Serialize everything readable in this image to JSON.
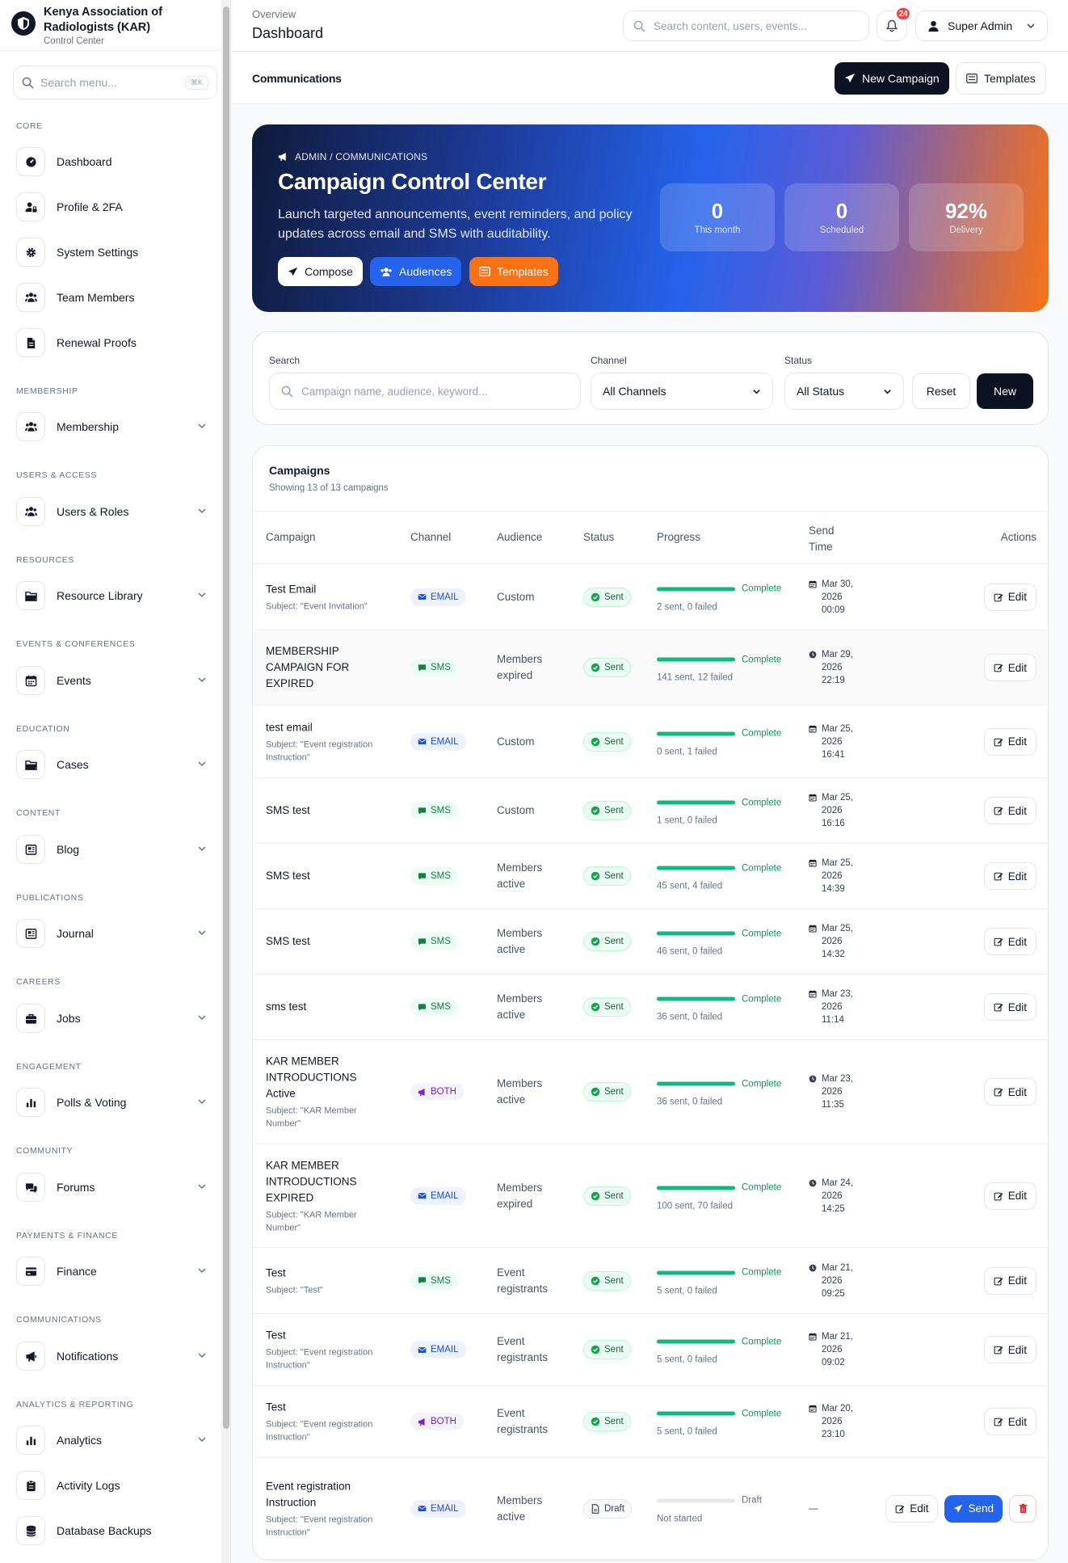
{
  "sidebar": {
    "brand_name": "Kenya Association of Radiologists (KAR)",
    "brand_sub": "Control Center",
    "search_placeholder": "Search menu...",
    "search_kbd": "⌘K",
    "sections": [
      {
        "label": "CORE"
      },
      {
        "label": "MEMBERSHIP"
      },
      {
        "label": "USERS & ACCESS"
      },
      {
        "label": "RESOURCES"
      },
      {
        "label": "EVENTS & CONFERENCES"
      },
      {
        "label": "EDUCATION"
      },
      {
        "label": "CONTENT"
      },
      {
        "label": "PUBLICATIONS"
      },
      {
        "label": "CAREERS"
      },
      {
        "label": "ENGAGEMENT"
      },
      {
        "label": "COMMUNITY"
      },
      {
        "label": "PAYMENTS & FINANCE"
      },
      {
        "label": "COMMUNICATIONS"
      },
      {
        "label": "ANALYTICS & REPORTING"
      }
    ],
    "items": [
      {
        "label": "Dashboard",
        "icon": "dashboard-icon"
      },
      {
        "label": "Profile & 2FA",
        "icon": "user-lock-icon"
      },
      {
        "label": "System Settings",
        "icon": "gear-icon"
      },
      {
        "label": "Team Members",
        "icon": "users-icon"
      },
      {
        "label": "Renewal Proofs",
        "icon": "file-icon"
      },
      {
        "label": "Membership",
        "icon": "users-icon"
      },
      {
        "label": "Users & Roles",
        "icon": "users-icon"
      },
      {
        "label": "Resource Library",
        "icon": "folder-icon"
      },
      {
        "label": "Events",
        "icon": "calendar-icon"
      },
      {
        "label": "Cases",
        "icon": "folder-icon"
      },
      {
        "label": "Blog",
        "icon": "newspaper-icon"
      },
      {
        "label": "Journal",
        "icon": "newspaper-icon"
      },
      {
        "label": "Jobs",
        "icon": "briefcase-icon"
      },
      {
        "label": "Polls & Voting",
        "icon": "bar-chart-icon"
      },
      {
        "label": "Forums",
        "icon": "comments-icon"
      },
      {
        "label": "Finance",
        "icon": "credit-card-icon"
      },
      {
        "label": "Notifications",
        "icon": "megaphone-icon"
      },
      {
        "label": "Analytics",
        "icon": "bar-chart-icon"
      },
      {
        "label": "Activity Logs",
        "icon": "clipboard-icon"
      },
      {
        "label": "Database Backups",
        "icon": "database-icon"
      }
    ]
  },
  "topbar": {
    "breadcrumb": "Overview",
    "title": "Dashboard",
    "search_placeholder": "Search content, users, events...",
    "notifications_count": "24",
    "user_label": "Super Admin"
  },
  "subbar": {
    "title": "Communications",
    "new_campaign": "New Campaign",
    "templates": "Templates"
  },
  "hero": {
    "crumb": "ADMIN / COMMUNICATIONS",
    "title": "Campaign Control Center",
    "description": "Launch targeted announcements, event reminders, and policy updates across email and SMS with auditability.",
    "buttons": {
      "compose": "Compose",
      "audiences": "Audiences",
      "templates": "Templates"
    },
    "stats": [
      {
        "value": "0",
        "label": "This month"
      },
      {
        "value": "0",
        "label": "Scheduled"
      },
      {
        "value": "92%",
        "label": "Delivery"
      }
    ]
  },
  "filters": {
    "search_label": "Search",
    "search_placeholder": "Campaign name, audience, keyword...",
    "channel_label": "Channel",
    "channel_value": "All Channels",
    "status_label": "Status",
    "status_value": "All Status",
    "reset": "Reset",
    "new": "New"
  },
  "campaigns": {
    "title": "Campaigns",
    "subtitle": "Showing 13 of 13 campaigns",
    "columns": {
      "campaign": "Campaign",
      "channel": "Channel",
      "audience": "Audience",
      "status": "Status",
      "progress": "Progress",
      "send_time": "Send Time",
      "actions": "Actions"
    },
    "edit_label": "Edit",
    "send_label": "Send",
    "rows": [
      {
        "name": "Test Email",
        "subject": "Subject: \"Event Invitation\"",
        "channel": "EMAIL",
        "audience": "Custom",
        "status": "Sent",
        "progress": 1,
        "progress_label": "Complete",
        "counts": "2 sent, 0 failed",
        "time_icon": "calendar-icon",
        "time": "Mar 30, 2026 00:09"
      },
      {
        "name": "MEMBERSHIP CAMPAIGN FOR EXPIRED",
        "subject": "",
        "channel": "SMS",
        "audience": "Members expired",
        "status": "Sent",
        "progress": 1,
        "progress_label": "Complete",
        "counts": "141 sent, 12 failed",
        "time_icon": "clock-icon",
        "time": "Mar 29, 2026 22:19"
      },
      {
        "name": "test email",
        "subject": "Subject: \"Event registration Instruction\"",
        "channel": "EMAIL",
        "audience": "Custom",
        "status": "Sent",
        "progress": 1,
        "progress_label": "Complete",
        "counts": "0 sent, 1 failed",
        "time_icon": "calendar-icon",
        "time": "Mar 25, 2026 16:41"
      },
      {
        "name": "SMS test",
        "subject": "",
        "channel": "SMS",
        "audience": "Custom",
        "status": "Sent",
        "progress": 1,
        "progress_label": "Complete",
        "counts": "1 sent, 0 failed",
        "time_icon": "calendar-icon",
        "time": "Mar 25, 2026 16:16"
      },
      {
        "name": "SMS test",
        "subject": "",
        "channel": "SMS",
        "audience": "Members active",
        "status": "Sent",
        "progress": 1,
        "progress_label": "Complete",
        "counts": "45 sent, 4 failed",
        "time_icon": "calendar-icon",
        "time": "Mar 25, 2026 14:39"
      },
      {
        "name": "SMS test",
        "subject": "",
        "channel": "SMS",
        "audience": "Members active",
        "status": "Sent",
        "progress": 1,
        "progress_label": "Complete",
        "counts": "46 sent, 0 failed",
        "time_icon": "calendar-icon",
        "time": "Mar 25, 2026 14:32"
      },
      {
        "name": "sms test",
        "subject": "",
        "channel": "SMS",
        "audience": "Members active",
        "status": "Sent",
        "progress": 1,
        "progress_label": "Complete",
        "counts": "36 sent, 0 failed",
        "time_icon": "calendar-icon",
        "time": "Mar 23, 2026 11:14"
      },
      {
        "name": "KAR MEMBER INTRODUCTIONS Active",
        "subject": "Subject: \"KAR Member Number\"",
        "channel": "BOTH",
        "audience": "Members active",
        "status": "Sent",
        "progress": 1,
        "progress_label": "Complete",
        "counts": "36 sent, 0 failed",
        "time_icon": "clock-icon",
        "time": "Mar 23, 2026 11:35"
      },
      {
        "name": "KAR MEMBER INTRODUCTIONS EXPIRED",
        "subject": "Subject: \"KAR Member Number\"",
        "channel": "EMAIL",
        "audience": "Members expired",
        "status": "Sent",
        "progress": 1,
        "progress_label": "Complete",
        "counts": "100 sent, 70 failed",
        "time_icon": "clock-icon",
        "time": "Mar 24, 2026 14:25"
      },
      {
        "name": "Test",
        "subject": "Subject: \"Test\"",
        "channel": "SMS",
        "audience": "Event registrants",
        "status": "Sent",
        "progress": 1,
        "progress_label": "Complete",
        "counts": "5 sent, 0 failed",
        "time_icon": "clock-icon",
        "time": "Mar 21, 2026 09:25"
      },
      {
        "name": "Test",
        "subject": "Subject: \"Event registration Instruction\"",
        "channel": "EMAIL",
        "audience": "Event registrants",
        "status": "Sent",
        "progress": 1,
        "progress_label": "Complete",
        "counts": "5 sent, 0 failed",
        "time_icon": "calendar-icon",
        "time": "Mar 21, 2026 09:02"
      },
      {
        "name": "Test",
        "subject": "Subject: \"Event registration Instruction\"",
        "channel": "BOTH",
        "audience": "Event registrants",
        "status": "Sent",
        "progress": 1,
        "progress_label": "Complete",
        "counts": "5 sent, 0 failed",
        "time_icon": "calendar-icon",
        "time": "Mar 20, 2026 23:10"
      },
      {
        "name": "Event registration Instruction",
        "subject": "Subject: \"Event registration Instruction\"",
        "channel": "EMAIL",
        "audience": "Members active",
        "status": "Draft",
        "progress": 0,
        "progress_label": "Draft",
        "counts": "Not started",
        "time_icon": "",
        "time": "—"
      }
    ]
  },
  "colors": {
    "accent": "#2563eb",
    "dark": "#0b1222",
    "orange": "#f97316",
    "success": "#10b981"
  }
}
